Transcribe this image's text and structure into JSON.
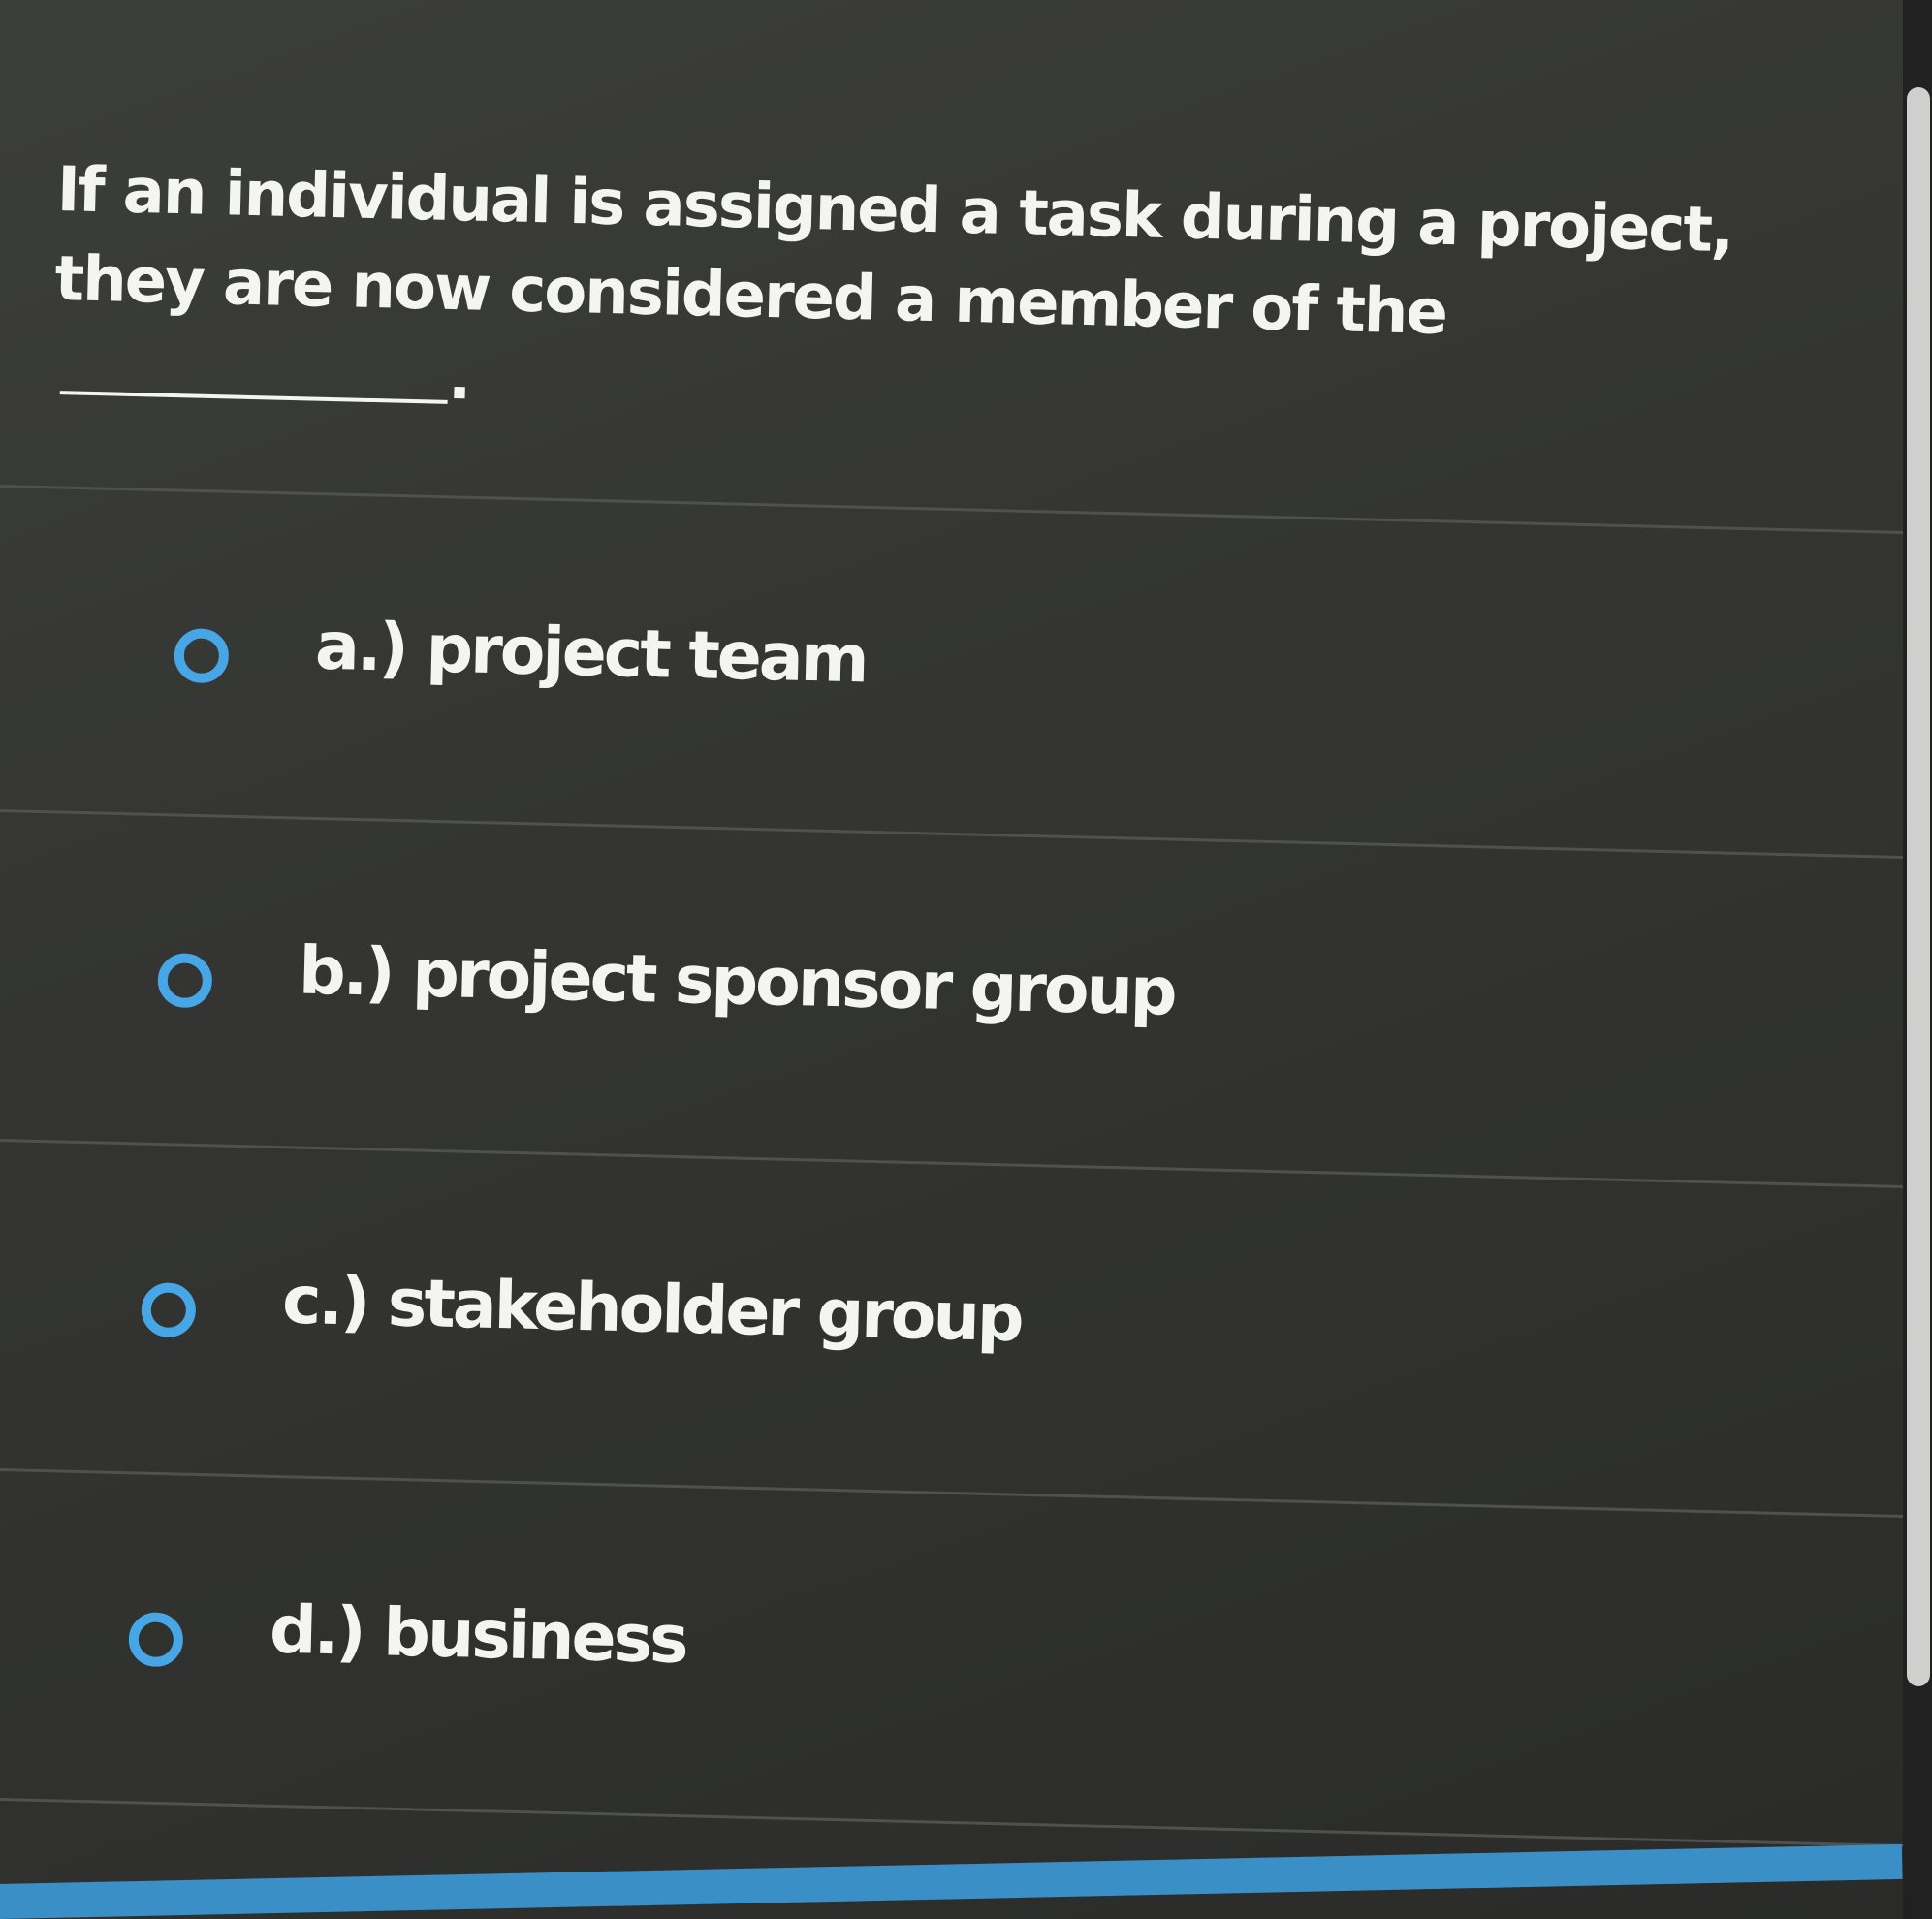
{
  "question": {
    "text": "If an individual is assigned a task during a project, they are now considered a member of the",
    "end_punctuation": "."
  },
  "options": [
    {
      "label": "a.) project team",
      "selected": false
    },
    {
      "label": "b.) project sponsor group",
      "selected": false
    },
    {
      "label": "c.) stakeholder group",
      "selected": false
    },
    {
      "label": "d.) business",
      "selected": false
    }
  ],
  "colors": {
    "radio": "#47a6e6",
    "background": "#343532",
    "text": "#f4f4f2"
  }
}
